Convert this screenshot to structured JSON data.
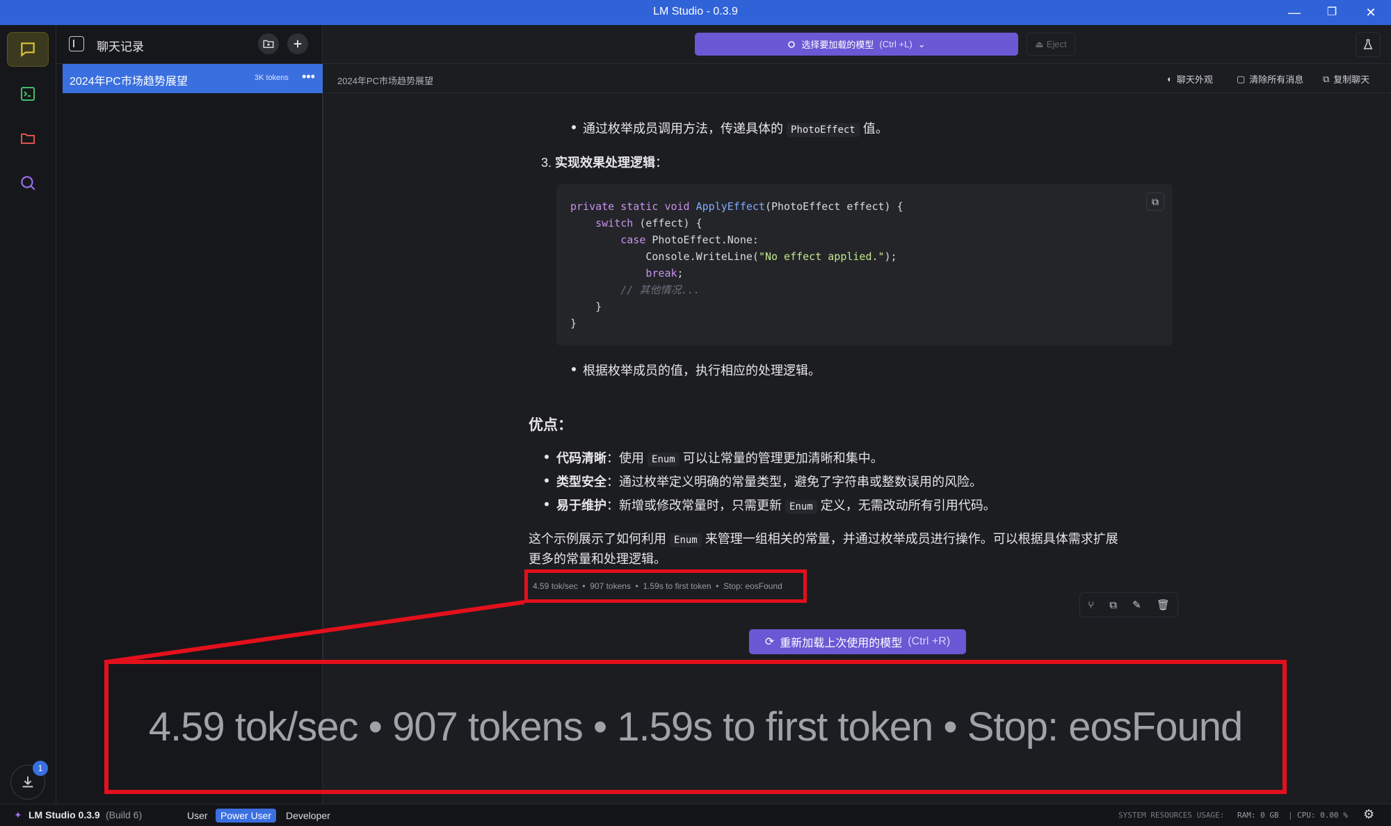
{
  "window": {
    "title": "LM Studio - 0.3.9",
    "minimize": "—",
    "restore": "❐",
    "close": "✕"
  },
  "sidebar": {
    "title": "聊天记录",
    "chats": [
      {
        "title": "2024年PC市场趋势展望",
        "tokens": "3K tokens"
      }
    ]
  },
  "topbar": {
    "model_select": "选择要加载的模型",
    "model_shortcut": "(Ctrl +L)",
    "eject": "Eject"
  },
  "crumbbar": {
    "breadcrumb": "2024年PC市场趋势展望",
    "actions": [
      "聊天外观",
      "清除所有消息",
      "复制聊天"
    ]
  },
  "message": {
    "bullet_top_pre": "通过枚举成员调用方法，传递具体的",
    "bullet_top_code": "PhotoEffect",
    "bullet_top_post": "值。",
    "step3_num": "3.",
    "step3_title": "实现效果处理逻辑",
    "step3_colon": "：",
    "code_lines": [
      "private static void ApplyEffect(PhotoEffect effect) {",
      "    switch (effect) {",
      "        case PhotoEffect.None:",
      "            Console.WriteLine(\"No effect applied.\");",
      "            break;",
      "        // 其他情况...",
      "    }",
      "}"
    ],
    "bullet_after_code": "根据枚举成员的值，执行相应的处理逻辑。",
    "pros_heading": "优点：",
    "pros": [
      {
        "bold": "代码清晰",
        "pre": "：使用",
        "code": "Enum",
        "post": "可以让常量的管理更加清晰和集中。"
      },
      {
        "bold": "类型安全",
        "pre": "：通过枚举定义明确的常量类型，避免了字符串或整数误用的风险。",
        "code": "",
        "post": ""
      },
      {
        "bold": "易于维护",
        "pre": "：新增或修改常量时，只需更新",
        "code": "Enum",
        "post": "定义，无需改动所有引用代码。"
      }
    ],
    "summary_pre": "这个示例展示了如何利用",
    "summary_code": "Enum",
    "summary_post": "来管理一组相关的常量，并通过枚举成员进行操作。可以根据具体需求扩展",
    "summary_line2": "更多的常量和处理逻辑。",
    "stats": "4.59 tok/sec  •  907 tokens  •  1.59s to first token  •  Stop: eosFound"
  },
  "reload_button": {
    "label": "重新加载上次使用的模型",
    "shortcut": "(Ctrl +R)"
  },
  "zoom_callout": {
    "text": "4.59 tok/sec • 907 tokens • 1.59s to first token • Stop: eosFound"
  },
  "statusbar": {
    "app_name": "LM Studio 0.3.9",
    "build": "(Build 6)",
    "modes": [
      "User",
      "Power User",
      "Developer"
    ],
    "active_mode": "Power User",
    "resources_label": "SYSTEM RESOURCES USAGE:",
    "ram": "RAM: 0 GB",
    "cpu": "CPU: 0.00 %",
    "download_badge": "1"
  },
  "colors": {
    "accent": "#3a6fe0",
    "purple": "#6a58d4",
    "highlight": "#e3101c",
    "titlebar": "#3163d8"
  }
}
